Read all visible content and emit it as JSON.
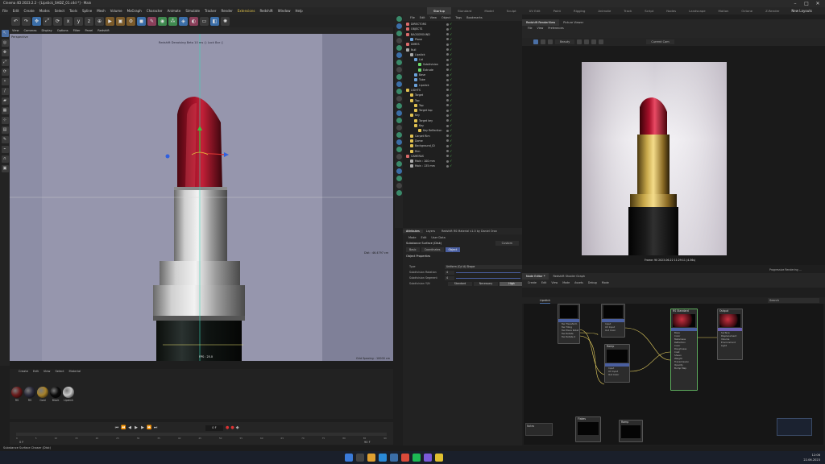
{
  "window": {
    "title": "Cinema 4D 2023.2.2 - [Lipstick_SHDZ_01.c4d *] - Main",
    "controls": [
      "–",
      "□",
      "✕"
    ]
  },
  "menu": [
    "File",
    "Edit",
    "Create",
    "Modes",
    "Select",
    "Tools",
    "Spline",
    "Mesh",
    "Volume",
    "MoGraph",
    "Character",
    "Animate",
    "Simulate",
    "Tracker",
    "Render",
    "Extensions",
    "Redshift",
    "Window",
    "Help"
  ],
  "layouts": [
    "Startup",
    "Standard",
    "Model",
    "Sculpt",
    "UV Edit",
    "Paint",
    "Rigging",
    "Animate",
    "Track",
    "Script",
    "Nodes",
    "Landscape",
    "Motion",
    "Octane",
    "Z-Render"
  ],
  "new_layouts": "New Layouts",
  "viewport": {
    "menu": [
      "View",
      "Cameras",
      "Display",
      "Options",
      "Filter",
      "Panel",
      "Redshift"
    ],
    "label": "Perspective",
    "hud": "Redshift Denoising   Beta   10 ms   ◎ Lock Bar   ◎",
    "distance": "Dist : 46.4797 cm",
    "grid": "Grid Spacing : 10000 cm",
    "fps": "FPS : 25.0"
  },
  "material_manager": {
    "menu": [
      "Create",
      "Edit",
      "View",
      "Select",
      "Material"
    ],
    "materials": [
      {
        "name": "RS",
        "color": "#6a1a1a"
      },
      {
        "name": "RS",
        "color": "#2a2a3a"
      },
      {
        "name": "Gold",
        "color": "#a8822a"
      },
      {
        "name": "Black",
        "color": "#0c0c0c"
      },
      {
        "name": "Lipstick",
        "color": "#c8c8c8"
      }
    ]
  },
  "timeline": {
    "frame": "0 F",
    "ticks": [
      "0",
      "5",
      "10",
      "15",
      "20",
      "25",
      "30",
      "35",
      "40",
      "45",
      "50",
      "55",
      "60",
      "65",
      "70",
      "75",
      "80",
      "85",
      "90"
    ],
    "start": "0 F",
    "end": "90 F"
  },
  "status": "Substance Surface Chaser (Disk)",
  "taskbar": {
    "time": "12:06",
    "date": "22.06.2023"
  },
  "object_manager": {
    "menu": [
      "File",
      "Edit",
      "View",
      "Object",
      "Tags",
      "Bookmarks"
    ],
    "rows": [
      {
        "name": "DIRECTORS",
        "indent": 0,
        "color": "#d96a6a"
      },
      {
        "name": "OBJECTS",
        "indent": 0,
        "color": "#d96a6a"
      },
      {
        "name": "BACKGROUND",
        "indent": 0,
        "color": "#d96a6a"
      },
      {
        "name": "Plane",
        "indent": 1,
        "color": "#6aa0d9"
      },
      {
        "name": "DIMES",
        "indent": 0,
        "color": "#d96a6a"
      },
      {
        "name": "Null",
        "indent": 0,
        "color": "#aaaaaa"
      },
      {
        "name": "Lipstick",
        "indent": 1,
        "color": "#aaaaaa"
      },
      {
        "name": "Lid",
        "indent": 2,
        "color": "#6aa0d9"
      },
      {
        "name": "Subdivision",
        "indent": 3,
        "color": "#6ad96a"
      },
      {
        "name": "Extrude",
        "indent": 3,
        "color": "#6ad96a"
      },
      {
        "name": "Base",
        "indent": 2,
        "color": "#6aa0d9"
      },
      {
        "name": "Tube",
        "indent": 2,
        "color": "#6aa0d9"
      },
      {
        "name": "Lipstick",
        "indent": 2,
        "color": "#6aa0d9"
      },
      {
        "name": "LIGHTS",
        "indent": 0,
        "color": "#e0c050"
      },
      {
        "name": "Target",
        "indent": 1,
        "color": "#e0c050"
      },
      {
        "name": "Top",
        "indent": 1,
        "color": "#e0c050"
      },
      {
        "name": "Top",
        "indent": 2,
        "color": "#e0c050"
      },
      {
        "name": "Target top",
        "indent": 2,
        "color": "#e0c050"
      },
      {
        "name": "Key",
        "indent": 1,
        "color": "#e0c050"
      },
      {
        "name": "Target key",
        "indent": 2,
        "color": "#e0c050"
      },
      {
        "name": "Key",
        "indent": 2,
        "color": "#e0c050"
      },
      {
        "name": "Key Reflection",
        "indent": 3,
        "color": "#e0c050"
      },
      {
        "name": "Carpet Rim",
        "indent": 1,
        "color": "#e0c050"
      },
      {
        "name": "Dome",
        "indent": 1,
        "color": "#e0c050"
      },
      {
        "name": "Background_ID",
        "indent": 1,
        "color": "#e0c050"
      },
      {
        "name": "Rim",
        "indent": 1,
        "color": "#e0c050"
      },
      {
        "name": "CAMERAS",
        "indent": 0,
        "color": "#d96a6a"
      },
      {
        "name": "Main : 100 mm",
        "indent": 1,
        "color": "#aaaaaa"
      },
      {
        "name": "Main : 135 mm",
        "indent": 1,
        "color": "#aaaaaa"
      }
    ]
  },
  "attributes": {
    "tabs": [
      "Attributes",
      "Layers",
      "Redshift RS Material v1.0 by Daniel Oran"
    ],
    "menu": [
      "Mode",
      "Edit",
      "User Data"
    ],
    "object_name": "Substance Surface (Disk)",
    "subtabs": [
      "Basic",
      "Coordinates",
      "Object"
    ],
    "section": "Object Properties",
    "props": [
      {
        "label": "Type",
        "value": "Uniform (Cyl A) Shape"
      },
      {
        "label": "Subdivision Rotation",
        "value": "4"
      },
      {
        "label": "Subdivision Segment",
        "value": "4"
      }
    ],
    "quality_label": "Subdivision Y/N",
    "quality": [
      "Standard",
      "Necessary",
      "High"
    ],
    "mode_select": "Custom"
  },
  "render_view": {
    "tabs": [
      "Redshift RenderView",
      "Picture Viewer"
    ],
    "menu": [
      "File",
      "View",
      "Preferences"
    ],
    "caption": "Frame: 90   2023-06-22   11:29:11   (4.36s)",
    "progress": "Progressive Rendering ...",
    "stage": "Beauty",
    "camera": "Current Cam"
  },
  "node_editor": {
    "tabs": [
      "Node Editor *",
      "Redshift Shader Graph"
    ],
    "menu": [
      "Create",
      "Edit",
      "View",
      "Mode",
      "Assets",
      "Debug",
      "Mode"
    ],
    "crumb": "Lipstick",
    "search": "Search",
    "nodes": [
      {
        "name": "",
        "ports": [
          "Tex Transform",
          "Tex Tiling",
          "Tex Place Rotat",
          "Tex Rotate",
          "Tex Rotate 2"
        ]
      },
      {
        "name": "",
        "ports": [
          "Input",
          "UV Input",
          "Out Color"
        ]
      },
      {
        "name": "Ramp",
        "ports": [
          "Input",
          "UV Input",
          "Out Color"
        ]
      },
      {
        "name": "RS Standard",
        "ports": [
          "Base",
          "Color",
          "Metalness",
          "Reflection",
          "Color",
          "Roughness",
          "Coat",
          "Sheen",
          "Weight",
          "Transmission",
          "Opacity",
          "Bump Map"
        ]
      },
      {
        "name": "Output",
        "ports": [
          "Surface",
          "Displacement",
          "Volume",
          "Environment",
          "Light"
        ]
      },
      {
        "name": "Flakes",
        "ports": []
      },
      {
        "name": "Ramp",
        "ports": []
      }
    ],
    "notes": "Notes"
  }
}
